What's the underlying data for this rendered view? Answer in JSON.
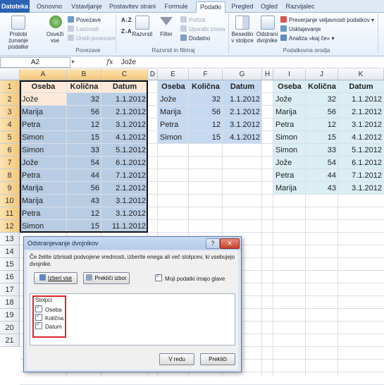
{
  "tabs": [
    "Datoteka",
    "Osnovno",
    "Vstavljanje",
    "Postavitev strani",
    "Formule",
    "Podatki",
    "Pregled",
    "Ogled",
    "Razvijalec"
  ],
  "active_tab": "Podatki",
  "ribbon": {
    "get_data_label": "Pridobi zunanje podatke",
    "refresh_label": "Osveži vse",
    "connections": [
      "Povezave",
      "Lastnosti",
      "Uredi povezave"
    ],
    "group_connections": "Povezave",
    "sort_label": "Razvrsti",
    "filter_label": "Filter",
    "filter_options": [
      "Počisti",
      "Uporabi znova",
      "Dodatno"
    ],
    "group_sort": "Razvrsti in filtriraj",
    "text_to_columns": "Besedilo v stolpce",
    "remove_duplicates": "Odstrani dvojnike",
    "validation": "Preverjanje veljavnosti podatkov",
    "consolidate": "Usklajevanje",
    "whatif": "Analiza »kaj če«",
    "group_tools": "Podatkovna orodja"
  },
  "formula_bar": {
    "name_box": "A2",
    "fx": "fx",
    "value": "Jože"
  },
  "grid": {
    "columns": [
      "A",
      "B",
      "C",
      "D",
      "E",
      "F",
      "G",
      "H",
      "I",
      "J",
      "K"
    ],
    "rows": [
      "1",
      "2",
      "3",
      "4",
      "5",
      "6",
      "7",
      "8",
      "9",
      "10",
      "11",
      "12",
      "13",
      "14",
      "15",
      "16",
      "17",
      "18",
      "19",
      "20",
      "21"
    ],
    "headers": {
      "name": "Oseba",
      "qty": "Količna",
      "date": "Datum"
    },
    "table1": [
      [
        "Jože",
        "32",
        "1.1.2012"
      ],
      [
        "Marija",
        "56",
        "2.1.2012"
      ],
      [
        "Petra",
        "12",
        "3.1.2012"
      ],
      [
        "Simon",
        "15",
        "4.1.2012"
      ],
      [
        "Simon",
        "33",
        "5.1.2012"
      ],
      [
        "Jože",
        "54",
        "6.1.2012"
      ],
      [
        "Petra",
        "44",
        "7.1.2012"
      ],
      [
        "Marija",
        "56",
        "2.1.2012"
      ],
      [
        "Marija",
        "43",
        "3.1.2012"
      ],
      [
        "Petra",
        "12",
        "3.1.2012"
      ],
      [
        "Simon",
        "15",
        "11.1.2012"
      ]
    ],
    "table2": [
      [
        "Jože",
        "32",
        "1.1.2012"
      ],
      [
        "Marija",
        "56",
        "2.1.2012"
      ],
      [
        "Petra",
        "12",
        "3.1.2012"
      ],
      [
        "Simon",
        "15",
        "4.1.2012"
      ]
    ],
    "table3": [
      [
        "Jože",
        "32",
        "1.1.2012"
      ],
      [
        "Marija",
        "56",
        "2.1.2012"
      ],
      [
        "Petra",
        "12",
        "3.1.2012"
      ],
      [
        "Simon",
        "15",
        "4.1.2012"
      ],
      [
        "Simon",
        "33",
        "5.1.2012"
      ],
      [
        "Jože",
        "54",
        "6.1.2012"
      ],
      [
        "Petra",
        "44",
        "7.1.2012"
      ],
      [
        "Marija",
        "43",
        "3.1.2012"
      ]
    ]
  },
  "dialog": {
    "title": "Odstranjevanje dvojnikov",
    "help": "?",
    "close": "✕",
    "description": "Če želite izbrisati podvojene vrednosti, izberite enega ali več stolpcev, ki vsebujejo dvojnike.",
    "select_all": "Izberi vse",
    "unselect_all": "Prekliči izbor",
    "has_headers": "Moji podatki imajo glave",
    "columns_label": "Stolpci",
    "columns": [
      "Oseba",
      "Količna",
      "Datum"
    ],
    "ok": "V redu",
    "cancel": "Prekliči"
  },
  "colors": {
    "selection": "#b8cce4",
    "table2": "#c5d9f1",
    "table3": "#daeef3",
    "highlight_red": "#d9262a"
  }
}
